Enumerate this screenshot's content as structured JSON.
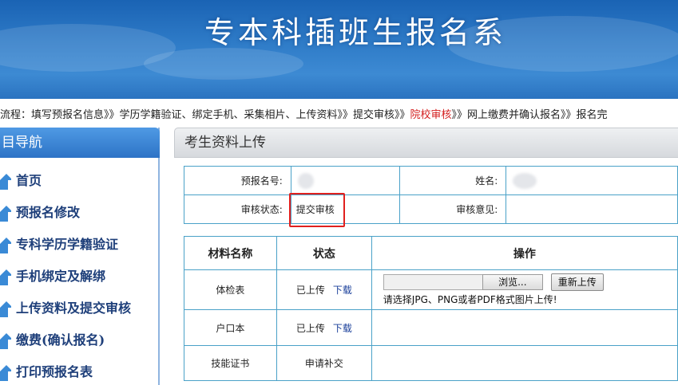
{
  "banner": {
    "title": "专本科插班生报名系"
  },
  "flow": {
    "prefix": "流程：",
    "steps_before": "填写预报名信息》》学历学籍验证、绑定手机、采集相片、上传资料》》提交审核》》",
    "current": "院校审核",
    "steps_after": "》》网上缴费并确认报名》》报名完"
  },
  "sidebar": {
    "header": "目导航",
    "items": [
      {
        "label": "首页"
      },
      {
        "label": "预报名修改"
      },
      {
        "label": "专科学历学籍验证"
      },
      {
        "label": "手机绑定及解绑"
      },
      {
        "label": "上传资料及提交审核"
      },
      {
        "label": "缴费(确认报名)"
      },
      {
        "label": "打印预报名表"
      }
    ]
  },
  "main": {
    "title": "考生资料上传",
    "info": {
      "prereg_no_label": "预报名号:",
      "prereg_no_value": "",
      "name_label": "姓名:",
      "name_value": "",
      "status_label": "审核状态:",
      "status_value": "提交审核",
      "opinion_label": "审核意见:",
      "opinion_value": ""
    },
    "materials": {
      "headers": {
        "name": "材料名称",
        "status": "状态",
        "ops": "操作"
      },
      "rows": [
        {
          "name": "体检表",
          "status": "已上传",
          "link": "下载"
        },
        {
          "name": "户口本",
          "status": "已上传",
          "link": "下载"
        },
        {
          "name": "技能证书",
          "status": "申请补交",
          "link": ""
        }
      ],
      "browse_label": "浏览...",
      "reupload_label": "重新上传",
      "hint": "请选择JPG、PNG或者PDF格式图片上传!"
    }
  },
  "colors": {
    "banner": "#2f7cc8",
    "sidebar_header": "#2d73c6",
    "nav_text": "#1e3f7a",
    "current_step": "#d42020",
    "table_border": "#4aa1c8",
    "highlight_box": "#e0201e"
  },
  "icons": {
    "nav_arrow": "up-arrow-icon"
  }
}
